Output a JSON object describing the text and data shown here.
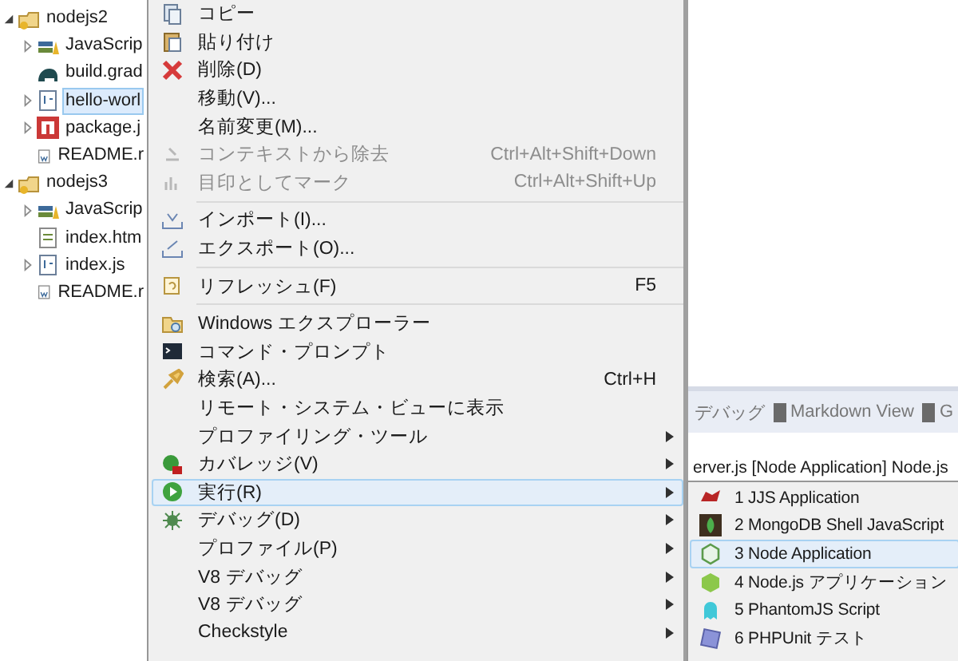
{
  "tree": [
    {
      "label": "nodejs2",
      "kind": "project",
      "expanded": true,
      "selected": false,
      "children": [
        {
          "label": "JavaScrip",
          "kind": "library",
          "expanded": false,
          "selected": false
        },
        {
          "label": "build.grad",
          "kind": "gradle",
          "selected": false
        },
        {
          "label": "hello-worl",
          "kind": "jsfile",
          "expanded": false,
          "selected": true
        },
        {
          "label": "package.j",
          "kind": "npm",
          "expanded": false,
          "selected": false
        },
        {
          "label": "README.r",
          "kind": "doc",
          "selected": false
        }
      ]
    },
    {
      "label": "nodejs3",
      "kind": "project",
      "expanded": true,
      "selected": false,
      "children": [
        {
          "label": "JavaScrip",
          "kind": "library",
          "expanded": false,
          "selected": false
        },
        {
          "label": "index.htm",
          "kind": "html",
          "selected": false
        },
        {
          "label": "index.js",
          "kind": "jsfile",
          "expanded": false,
          "selected": false
        },
        {
          "label": "README.r",
          "kind": "doc",
          "selected": false
        }
      ]
    }
  ],
  "views_tabs": [
    {
      "label": "デバッグ"
    },
    {
      "label": "Markdown View"
    },
    {
      "label": "G"
    }
  ],
  "console_line": "erver.js [Node Application] Node.js",
  "context_menu": [
    {
      "kind": "item",
      "label": "コピー",
      "disabled": false,
      "submenu": false,
      "selected": false
    },
    {
      "kind": "item",
      "label": "貼り付け",
      "disabled": false,
      "submenu": false,
      "selected": false
    },
    {
      "kind": "item",
      "label": "削除(D)",
      "disabled": false,
      "submenu": false,
      "selected": false
    },
    {
      "kind": "item",
      "label": "移動(V)...",
      "disabled": false,
      "submenu": false,
      "selected": false
    },
    {
      "kind": "item",
      "label": "名前変更(M)...",
      "disabled": false,
      "submenu": false,
      "selected": false
    },
    {
      "kind": "item",
      "label": "コンテキストから除去",
      "shortcut": "Ctrl+Alt+Shift+Down",
      "disabled": true,
      "submenu": false,
      "selected": false
    },
    {
      "kind": "item",
      "label": "目印としてマーク",
      "shortcut": "Ctrl+Alt+Shift+Up",
      "disabled": true,
      "submenu": false,
      "selected": false
    },
    {
      "kind": "separator"
    },
    {
      "kind": "item",
      "label": "インポート(I)...",
      "disabled": false,
      "submenu": false,
      "selected": false
    },
    {
      "kind": "item",
      "label": "エクスポート(O)...",
      "disabled": false,
      "submenu": false,
      "selected": false
    },
    {
      "kind": "separator"
    },
    {
      "kind": "item",
      "label": "リフレッシュ(F)",
      "shortcut": "F5",
      "disabled": false,
      "submenu": false,
      "selected": false
    },
    {
      "kind": "separator"
    },
    {
      "kind": "item",
      "label": "Windows エクスプローラー",
      "disabled": false,
      "submenu": false,
      "selected": false
    },
    {
      "kind": "item",
      "label": "コマンド・プロンプト",
      "disabled": false,
      "submenu": false,
      "selected": false
    },
    {
      "kind": "item",
      "label": "検索(A)...",
      "shortcut": "Ctrl+H",
      "disabled": false,
      "submenu": false,
      "selected": false
    },
    {
      "kind": "item",
      "label": "リモート・システム・ビューに表示",
      "disabled": false,
      "submenu": false,
      "selected": false
    },
    {
      "kind": "item",
      "label": "プロファイリング・ツール",
      "disabled": false,
      "submenu": true,
      "selected": false
    },
    {
      "kind": "item",
      "label": "カバレッジ(V)",
      "disabled": false,
      "submenu": true,
      "selected": false
    },
    {
      "kind": "item",
      "label": "実行(R)",
      "disabled": false,
      "submenu": true,
      "selected": true
    },
    {
      "kind": "item",
      "label": "デバッグ(D)",
      "disabled": false,
      "submenu": true,
      "selected": false
    },
    {
      "kind": "item",
      "label": "プロファイル(P)",
      "disabled": false,
      "submenu": true,
      "selected": false
    },
    {
      "kind": "item",
      "label": "V8 デバッグ",
      "disabled": false,
      "submenu": true,
      "selected": false
    },
    {
      "kind": "item",
      "label": "V8 デバッグ",
      "disabled": false,
      "submenu": true,
      "selected": false
    },
    {
      "kind": "item",
      "label": "Checkstyle",
      "disabled": false,
      "submenu": true,
      "selected": false
    }
  ],
  "run_submenu": [
    {
      "label": "1 JJS Application",
      "selected": false
    },
    {
      "label": "2 MongoDB Shell JavaScript",
      "selected": false
    },
    {
      "label": "3 Node Application",
      "selected": true
    },
    {
      "label": "4 Node.js アプリケーション",
      "selected": false
    },
    {
      "label": "5 PhantomJS Script",
      "selected": false
    },
    {
      "label": "6 PHPUnit テスト",
      "selected": false
    }
  ]
}
